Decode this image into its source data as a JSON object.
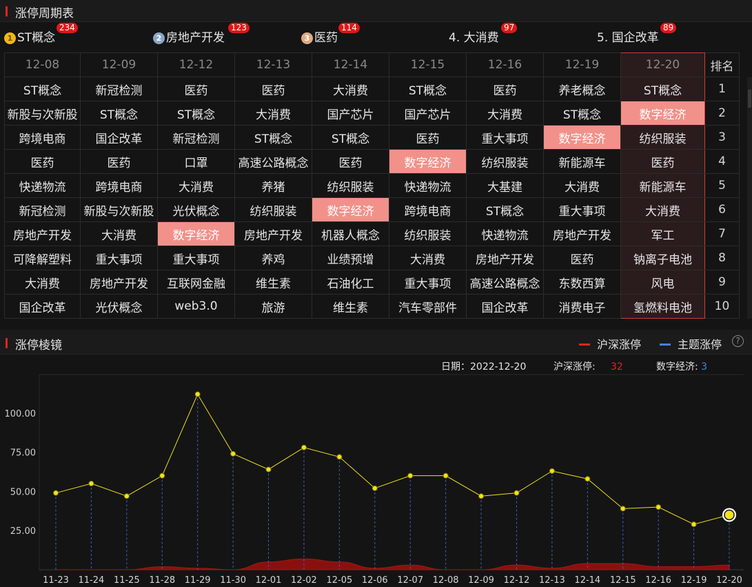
{
  "section1": {
    "title": "涨停周期表"
  },
  "top_ranks": [
    {
      "rank_icon": "1",
      "label": "ST概念",
      "count": "234",
      "medal": "gold"
    },
    {
      "rank_icon": "2",
      "label": "房地产开发",
      "count": "123",
      "medal": "silver"
    },
    {
      "rank_icon": "3",
      "label": "医药",
      "count": "114",
      "medal": "bronze"
    },
    {
      "rank_icon": "",
      "label": "4. 大消费",
      "count": "97",
      "medal": ""
    },
    {
      "rank_icon": "",
      "label": "5. 国企改革",
      "count": "89",
      "medal": ""
    }
  ],
  "cycle_table": {
    "dates": [
      "12-08",
      "12-09",
      "12-12",
      "12-13",
      "12-14",
      "12-15",
      "12-16",
      "12-19",
      "12-20"
    ],
    "rank_header": "排名",
    "rows": [
      {
        "rank": "1",
        "cells": [
          "ST概念",
          "新冠检测",
          "医药",
          "医药",
          "大消费",
          "ST概念",
          "医药",
          "养老概念",
          "ST概念"
        ]
      },
      {
        "rank": "2",
        "cells": [
          "新股与次新股",
          "ST概念",
          "ST概念",
          "大消费",
          "国产芯片",
          "国产芯片",
          "大消费",
          "ST概念",
          "数字经济"
        ]
      },
      {
        "rank": "3",
        "cells": [
          "跨境电商",
          "国企改革",
          "新冠检测",
          "ST概念",
          "ST概念",
          "医药",
          "重大事项",
          "数字经济",
          "纺织服装"
        ]
      },
      {
        "rank": "4",
        "cells": [
          "医药",
          "医药",
          "口罩",
          "高速公路概念",
          "医药",
          "数字经济",
          "纺织服装",
          "新能源车",
          "医药"
        ]
      },
      {
        "rank": "5",
        "cells": [
          "快递物流",
          "跨境电商",
          "大消费",
          "养猪",
          "纺织服装",
          "快递物流",
          "大基建",
          "大消费",
          "新能源车"
        ]
      },
      {
        "rank": "6",
        "cells": [
          "新冠检测",
          "新股与次新股",
          "光伏概念",
          "纺织服装",
          "数字经济",
          "跨境电商",
          "ST概念",
          "重大事项",
          "大消费"
        ]
      },
      {
        "rank": "7",
        "cells": [
          "房地产开发",
          "大消费",
          "数字经济",
          "房地产开发",
          "机器人概念",
          "纺织服装",
          "快递物流",
          "房地产开发",
          "军工"
        ]
      },
      {
        "rank": "8",
        "cells": [
          "可降解塑料",
          "重大事项",
          "重大事项",
          "养鸡",
          "业绩预增",
          "大消费",
          "房地产开发",
          "医药",
          "钠离子电池"
        ]
      },
      {
        "rank": "9",
        "cells": [
          "大消费",
          "房地产开发",
          "互联网金融",
          "维生素",
          "石油化工",
          "重大事项",
          "高速公路概念",
          "东数西算",
          "风电"
        ]
      },
      {
        "rank": "10",
        "cells": [
          "国企改革",
          "光伏概念",
          "web3.0",
          "旅游",
          "维生素",
          "汽车零部件",
          "国企改革",
          "消费电子",
          "氢燃料电池"
        ]
      }
    ],
    "highlight_topic": "数字经济",
    "today_date": "12-20"
  },
  "section2": {
    "title": "涨停棱镜"
  },
  "legend": {
    "main": "沪深涨停",
    "topic": "主题涨停",
    "main_color": "#e02424",
    "topic_color": "#4a7fe0"
  },
  "info": {
    "date_label": "日期：",
    "date_value": "2022-12-20",
    "main_label": "沪深涨停:",
    "main_value": "32",
    "topic_label": "数字经济:",
    "topic_value": "3"
  },
  "chart_data": {
    "type": "line",
    "x": [
      "11-23",
      "11-24",
      "11-25",
      "11-28",
      "11-29",
      "11-30",
      "12-01",
      "12-02",
      "12-05",
      "12-06",
      "12-07",
      "12-08",
      "12-09",
      "12-12",
      "12-13",
      "12-14",
      "12-15",
      "12-16",
      "12-19",
      "12-20"
    ],
    "series": [
      {
        "name": "沪深涨停",
        "type": "line",
        "color": "#f0e020",
        "values": [
          49,
          55,
          47,
          60,
          112,
          74,
          64,
          78,
          72,
          52,
          60,
          60,
          47,
          49,
          63,
          58,
          39,
          40,
          29,
          35
        ]
      },
      {
        "name": "主题涨停",
        "type": "area",
        "color": "#8a1010",
        "values": [
          0,
          0,
          0,
          2,
          1,
          0,
          5,
          7,
          5,
          1,
          3,
          0,
          0,
          3,
          1,
          4,
          4,
          2,
          2,
          3
        ]
      }
    ],
    "yticks": [
      25,
      50,
      75,
      100
    ],
    "ylim": [
      0,
      125
    ],
    "grid": false
  }
}
